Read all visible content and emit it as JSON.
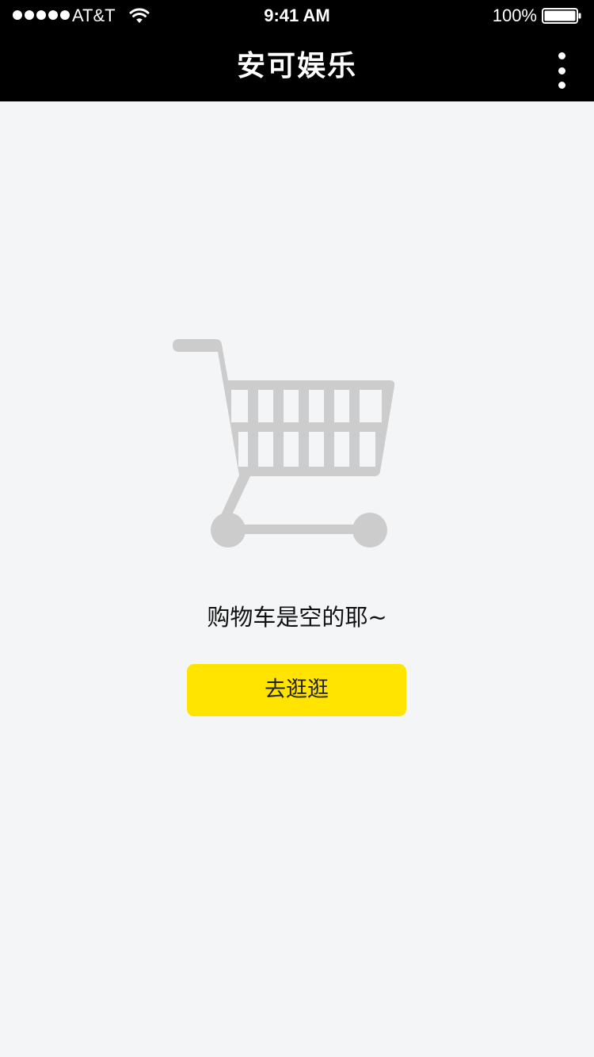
{
  "status_bar": {
    "carrier": "AT&T",
    "time": "9:41 AM",
    "battery_percent": "100%",
    "battery_level": 1.0
  },
  "nav": {
    "title": "安可娱乐",
    "more_icon": "more-vertical-icon"
  },
  "empty_state": {
    "icon": "shopping-cart-icon",
    "message": "购物车是空的耶~",
    "button_label": "去逛逛"
  },
  "colors": {
    "nav_background": "#000000",
    "page_background": "#f4f5f7",
    "accent": "#ffe400",
    "icon_gray": "#cccccc"
  }
}
